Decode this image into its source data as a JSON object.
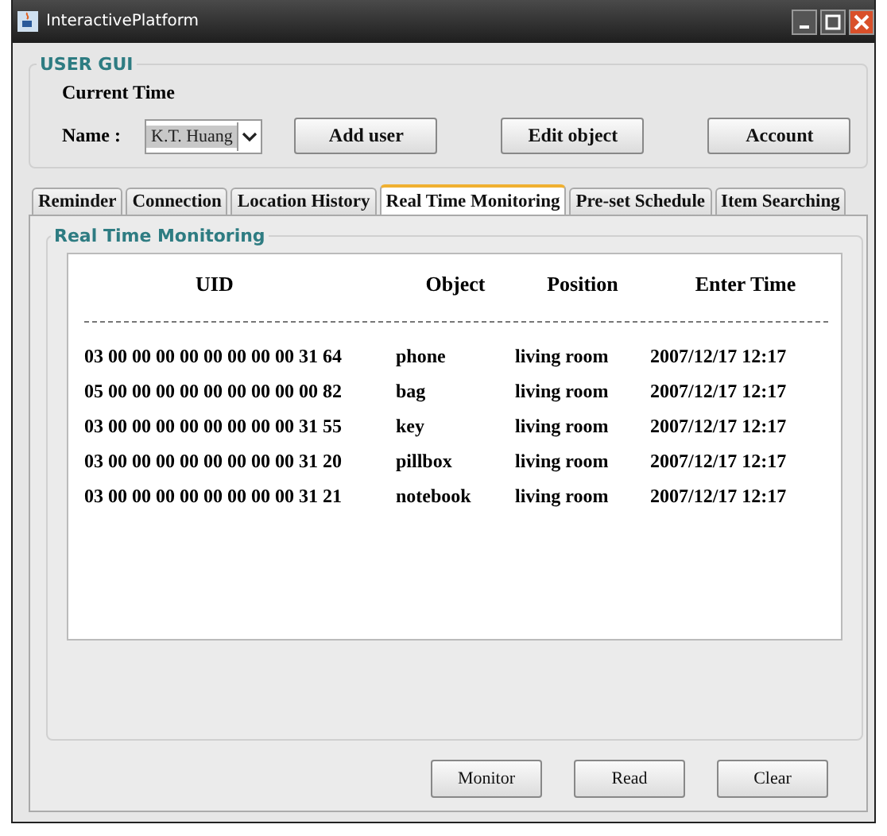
{
  "window": {
    "title": "InteractivePlatform"
  },
  "user_gui": {
    "title": "USER GUI",
    "current_time_label": "Current Time",
    "name_label": "Name :",
    "name_value": "K.T. Huang",
    "buttons": [
      "Add user",
      "Edit object",
      "Account"
    ]
  },
  "tabs": [
    {
      "label": "Reminder",
      "selected": false
    },
    {
      "label": "Connection",
      "selected": false
    },
    {
      "label": "Location History",
      "selected": false
    },
    {
      "label": "Real Time Monitoring",
      "selected": true
    },
    {
      "label": "Pre-set Schedule",
      "selected": false
    },
    {
      "label": "Item Searching",
      "selected": false
    }
  ],
  "panel": {
    "title": "Real Time Monitoring",
    "columns": [
      "UID",
      "Object",
      "Position",
      "Enter Time"
    ],
    "rows": [
      [
        "03 00 00 00 00 00 00 00 00 31 64",
        "phone",
        "living room",
        "2007/12/17 12:17"
      ],
      [
        "05 00 00 00 00 00 00 00 00 00 82",
        "bag",
        "living room",
        "2007/12/17 12:17"
      ],
      [
        "03 00 00 00 00 00 00 00 00 31 55",
        "key",
        "living room",
        "2007/12/17 12:17"
      ],
      [
        "03 00 00 00 00 00 00 00 00 31 20",
        "pillbox",
        "living room",
        "2007/12/17 12:17"
      ],
      [
        "03 00 00 00 00 00 00 00 00 31 21",
        "notebook",
        "living room",
        "2007/12/17 12:17"
      ]
    ],
    "buttons": [
      "Monitor",
      "Read",
      "Clear"
    ]
  }
}
